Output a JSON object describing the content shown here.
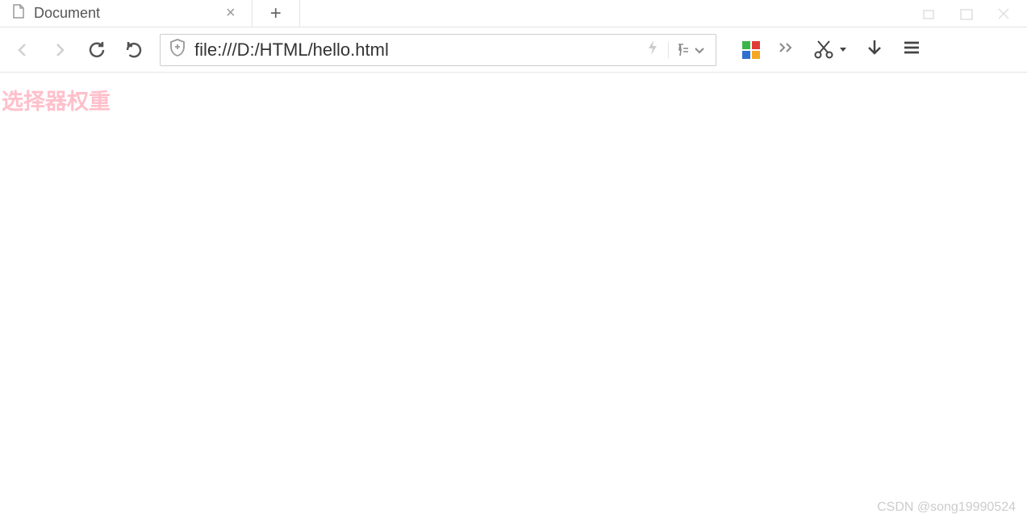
{
  "tab": {
    "title": "Document",
    "icon": "page-icon"
  },
  "navigation": {
    "url": "file:///D:/HTML/hello.html"
  },
  "page_content": {
    "text": "选择器权重",
    "color": "#ffc0cb"
  },
  "icons": {
    "back": "back-icon",
    "forward": "forward-icon",
    "reload": "reload-icon",
    "undo": "undo-icon",
    "shield": "shield-icon",
    "bolt": "bolt-icon",
    "funnel": "funnel-icon",
    "chevron_down": "chevron-down-icon",
    "ms_logo": "microsoft-logo-icon",
    "more": "more-icon",
    "scissors": "scissors-icon",
    "dropdown_caret": "dropdown-caret-icon",
    "download": "download-icon",
    "menu": "menu-icon",
    "close": "close-icon",
    "new_tab": "plus-icon"
  },
  "watermark": "CSDN @song19990524"
}
